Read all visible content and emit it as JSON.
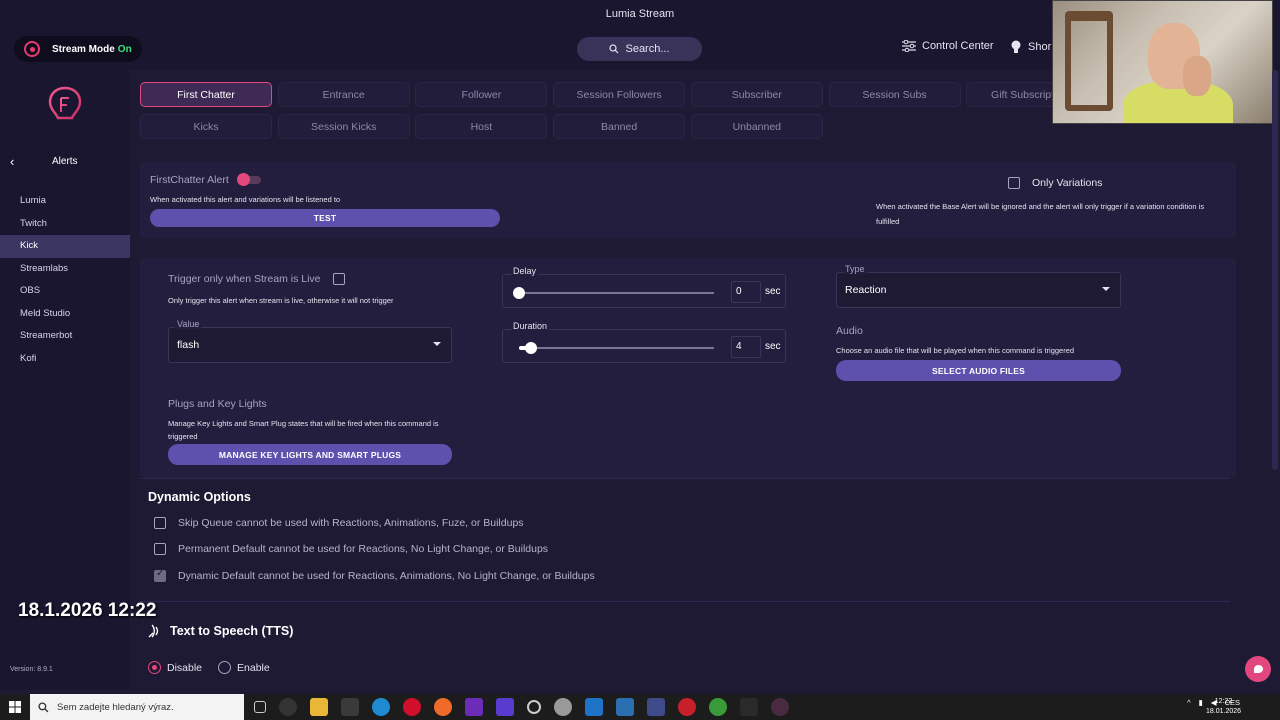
{
  "window": {
    "title": "Lumia Stream"
  },
  "topbar": {
    "stream_mode_label": "Stream Mode",
    "stream_mode_state": "On",
    "search_placeholder": "Search...",
    "control_center": "Control Center",
    "shortcuts": "Shor"
  },
  "sidebar": {
    "back_label": "Alerts",
    "items": [
      {
        "label": "Lumia"
      },
      {
        "label": "Twitch"
      },
      {
        "label": "Kick"
      },
      {
        "label": "Streamlabs"
      },
      {
        "label": "OBS"
      },
      {
        "label": "Meld Studio"
      },
      {
        "label": "Streamerbot"
      },
      {
        "label": "Kofi"
      }
    ],
    "active_index": 2,
    "version": "Version: 8.9.1",
    "overlay_datetime": "18.1.2026 12:22"
  },
  "tabs": {
    "row1": [
      "First Chatter",
      "Entrance",
      "Follower",
      "Session Followers",
      "Subscriber",
      "Session Subs",
      "Gift Subscriptions"
    ],
    "row2": [
      "Kicks",
      "Session Kicks",
      "Host",
      "Banned",
      "Unbanned"
    ],
    "active": "First Chatter"
  },
  "alert": {
    "title": "FirstChatter Alert",
    "description": "When activated this alert and variations will be listened to",
    "test_button": "TEST",
    "only_variations_label": "Only Variations",
    "only_variations_desc": "When activated the Base Alert will be ignored and the alert will only trigger if a variation condition is fulfilled"
  },
  "settings": {
    "trigger_live_label": "Trigger only when Stream is Live",
    "trigger_live_desc": "Only trigger this alert when stream is live, otherwise it will not trigger",
    "value_label": "Value",
    "value": "flash",
    "delay_label": "Delay",
    "delay_value": "0",
    "delay_unit": "sec",
    "delay_level": 0,
    "duration_label": "Duration",
    "duration_value": "4",
    "duration_unit": "sec",
    "duration_level": 0.06,
    "type_label": "Type",
    "type_value": "Reaction",
    "audio_label": "Audio",
    "audio_desc": "Choose an audio file that will be played when this command is triggered",
    "audio_button": "SELECT AUDIO FILES",
    "plugs_label": "Plugs and Key Lights",
    "plugs_desc": "Manage Key Lights and Smart Plug states that will be fired when this command is triggered",
    "plugs_button": "MANAGE KEY LIGHTS AND SMART PLUGS"
  },
  "dynamic": {
    "title": "Dynamic Options",
    "options": [
      {
        "label": "Skip Queue cannot be used with Reactions, Animations, Fuze, or Buildups",
        "checked": false
      },
      {
        "label": "Permanent Default cannot be used for Reactions, No Light Change, or Buildups",
        "checked": false
      },
      {
        "label": "Dynamic Default cannot be used for Reactions, Animations, No Light Change, or Buildups",
        "checked": true
      }
    ]
  },
  "tts": {
    "title": "Text to Speech (TTS)",
    "disable_label": "Disable",
    "enable_label": "Enable",
    "selected": "Disable"
  },
  "taskbar": {
    "search_placeholder": "Sem zadejte hledaný výraz.",
    "language": "CES",
    "time": "12:22",
    "date": "18.01.2026"
  },
  "colors": {
    "accent_pink": "#e2487e",
    "button_purple": "#5d51ad",
    "background": "#1e1a33",
    "stream_on_green": "#3ce07d"
  }
}
